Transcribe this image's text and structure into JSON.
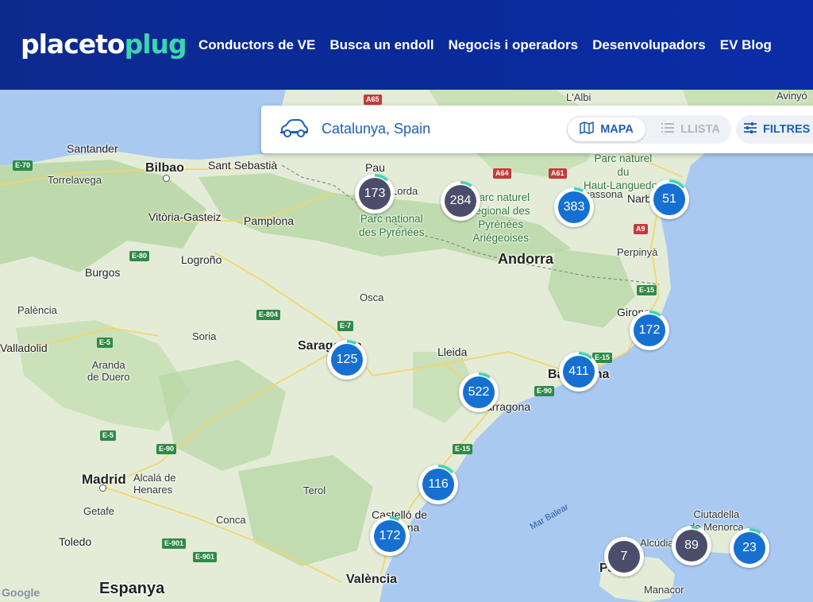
{
  "header": {
    "logo_part1": "placeto",
    "logo_part2": "plug",
    "nav": [
      "Conductors de VE",
      "Busca un endoll",
      "Negocis i operadors",
      "Desenvolupadors",
      "EV Blog"
    ]
  },
  "search": {
    "location": "Catalunya, Spain",
    "map_tab": "MAPA",
    "list_tab": "LLISTA",
    "filters": "FILTRES"
  },
  "map": {
    "labels": {
      "santander": "Santander",
      "torrelavega": "Torrelavega",
      "bilbao": "Bilbao",
      "sant_sebastia": "Sant Sebastià",
      "pau": "Pau",
      "lorda": "Lorda",
      "vitoria": "Vitòria-Gasteiz",
      "pamplona": "Pamplona",
      "logrono": "Logroño",
      "burgos": "Burgos",
      "palencia": "Palència",
      "valladolid": "Valladolid",
      "soria": "Soria",
      "aranda": "Aranda\nde Duero",
      "osca": "Osca",
      "saragossa": "Saragossa",
      "lleida": "Lleida",
      "andorra": "Andorra",
      "barcelona": "Barcelona",
      "tarragona": "Tarragona",
      "girona": "Girona",
      "perpinya": "Perpinyà",
      "narbona": "Narbona",
      "carcassona": "Carcassona",
      "lalbi": "L'Albi",
      "avinyo": "Avinyó",
      "madrid": "Madrid",
      "alcala": "Alcalá de\nHenares",
      "getafe": "Getafe",
      "toledo": "Toledo",
      "terol": "Terol",
      "conca": "Conca",
      "castello": "Castelló de\nla Plana",
      "valencia": "València",
      "espanya": "Espanya",
      "palma": "Palma",
      "alcudia": "Alcúdia",
      "manacor": "Manacor",
      "ciutadella": "Ciutadella\nde Menorca",
      "park_pyr": "Parc national\ndes Pyrénées",
      "park_ari": "Parc naturel\nrégional des\nPyrénées\nAriégeoises",
      "park_hl": "Parc naturel\ndu\nHaut-Languedoc",
      "mar_balear": "Mar Balear"
    },
    "roads": {
      "e70": "E-70",
      "e80": "E-80",
      "e804": "E-804",
      "e7": "E-7",
      "e5a": "E-5",
      "e5b": "E-5",
      "e90a": "E-90",
      "e90b": "E-90",
      "e15a": "E-15",
      "e15b": "E-15",
      "e15c": "E-15",
      "e901a": "E-901",
      "e901b": "E-901",
      "a65": "A65",
      "a64": "A64",
      "a61": "A61",
      "a9": "A9"
    },
    "clusters": {
      "pau": "173",
      "ariege": "284",
      "carcassonne": "383",
      "narbonne": "51",
      "girona": "172",
      "saragossa": "125",
      "barcelona": "411",
      "tarragona": "522",
      "valencia_n": "116",
      "castello": "172",
      "palma": "7",
      "menorca_w": "89",
      "menorca_e": "23"
    },
    "attribution": "Google"
  },
  "colors": {
    "header_bg": "#0c2a8e",
    "brand_accent": "#3ad6b0",
    "cluster_blue": "#1670d2",
    "cluster_dark": "#4b4e6b",
    "progress_ring": "#3ad6b0",
    "sea": "#a8c8f0",
    "land": "#e3ecd6",
    "forest": "#b5d6a3"
  }
}
